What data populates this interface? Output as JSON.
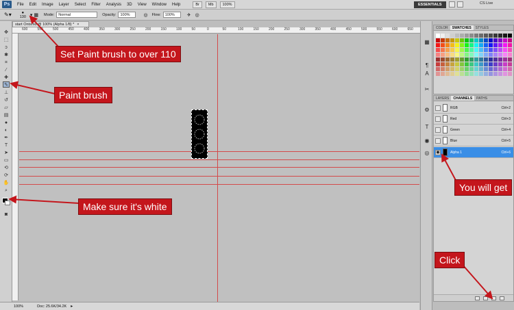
{
  "menu": {
    "logo": "Ps",
    "items": [
      "File",
      "Edit",
      "Image",
      "Layer",
      "Select",
      "Filter",
      "Analysis",
      "3D",
      "View",
      "Window",
      "Help"
    ],
    "zoom_btn": "100%",
    "essentials": "ESSENTIALS",
    "cs_live": "CS Live"
  },
  "options": {
    "brush_size": "130",
    "mode_label": "Mode:",
    "mode_value": "Normal",
    "opacity_label": "Opacity:",
    "opacity_value": "100%",
    "flow_label": "Flow:",
    "flow_value": "100%"
  },
  "document": {
    "tab_title": "start Ontsmd @ 100% (Alpha 1/8) *"
  },
  "ruler": {
    "ticks": [
      "600",
      "550",
      "500",
      "450",
      "400",
      "350",
      "300",
      "250",
      "200",
      "150",
      "100",
      "50",
      "0",
      "50",
      "100",
      "150",
      "200",
      "250",
      "300",
      "350",
      "400",
      "450",
      "500",
      "550",
      "600",
      "650"
    ]
  },
  "status": {
    "zoom": "100%",
    "doc": "Doc: 25.6K/34.2K"
  },
  "swatch_panel": {
    "tabs": [
      "COLOR",
      "SWATCHES",
      "STYLES"
    ]
  },
  "channels_panel": {
    "tabs": [
      "LAYERS",
      "CHANNELS",
      "PATHS"
    ],
    "channels": [
      {
        "name": "RGB",
        "shortcut": "Ctrl+2"
      },
      {
        "name": "Red",
        "shortcut": "Ctrl+3"
      },
      {
        "name": "Green",
        "shortcut": "Ctrl+4"
      },
      {
        "name": "Blue",
        "shortcut": "Ctrl+5"
      },
      {
        "name": "Alpha 1",
        "shortcut": "Ctrl+6"
      }
    ]
  },
  "annotations": {
    "brush_size": "Set Paint brush to over 110",
    "paint_brush": "Paint brush",
    "white": "Make sure it's white",
    "you_will_get": "You will get",
    "click": "Click"
  },
  "colors": {
    "callout_red": "#c4161c",
    "guide_red": "#d34a4a",
    "selected_channel": "#3a8ee6"
  }
}
